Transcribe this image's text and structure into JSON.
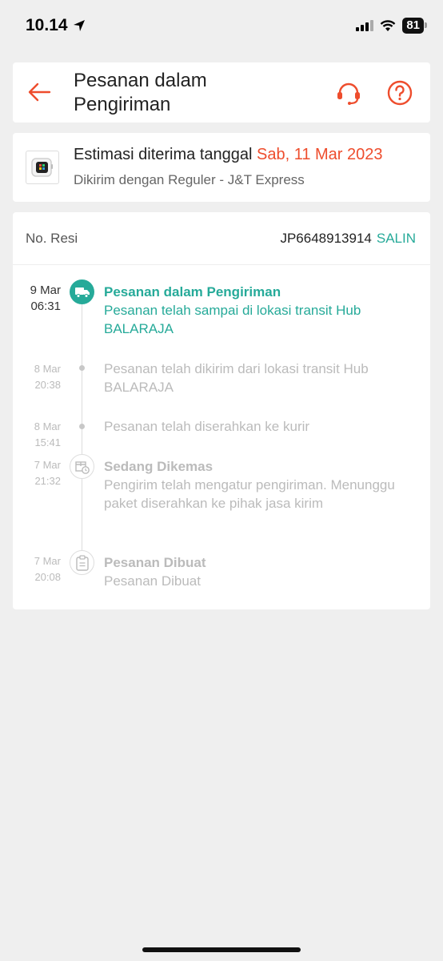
{
  "status_bar": {
    "time": "10.14",
    "battery": "81"
  },
  "header": {
    "title": "Pesanan dalam Pengiriman"
  },
  "delivery": {
    "estimate_label": "Estimasi diterima tanggal",
    "estimate_date": "Sab, 11 Mar 2023",
    "shipping_info": "Dikirim dengan Reguler - J&T Express"
  },
  "tracking": {
    "resi_label": "No. Resi",
    "resi_number": "JP6648913914",
    "copy_label": "SALIN",
    "events": [
      {
        "date": "9 Mar",
        "time": "06:31",
        "title": "Pesanan dalam Pengiriman",
        "description": "Pesanan telah sampai di lokasi transit Hub BALARAJA"
      },
      {
        "date": "8 Mar",
        "time": "20:38",
        "title": "",
        "description": "Pesanan telah dikirim dari lokasi transit Hub BALARAJA"
      },
      {
        "date": "8 Mar",
        "time": "15:41",
        "title": "",
        "description": "Pesanan telah diserahkan ke kurir"
      },
      {
        "date": "7 Mar",
        "time": "21:32",
        "title": "Sedang Dikemas",
        "description": "Pengirim telah mengatur pengiriman. Menunggu paket diserahkan ke pihak jasa kirim"
      },
      {
        "date": "7 Mar",
        "time": "20:08",
        "title": "Pesanan Dibuat",
        "description": "Pesanan Dibuat"
      }
    ]
  },
  "colors": {
    "accent": "#ee4d2d",
    "teal": "#26aa99",
    "muted": "#bbbbbb",
    "background": "#efefef"
  },
  "icons": [
    "location-arrow-icon",
    "signal-icon",
    "wifi-icon",
    "back-arrow-icon",
    "headset-icon",
    "help-icon",
    "watch-icon",
    "truck-icon",
    "package-clock-icon",
    "clipboard-icon"
  ]
}
